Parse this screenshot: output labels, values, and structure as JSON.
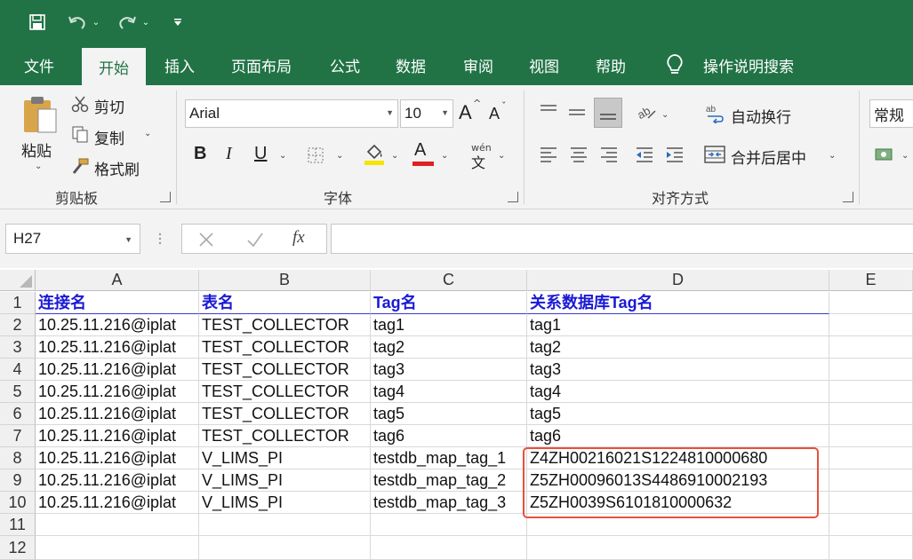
{
  "tabs": [
    {
      "label": "文件",
      "active": false
    },
    {
      "label": "开始",
      "active": true
    },
    {
      "label": "插入",
      "active": false
    },
    {
      "label": "页面布局",
      "active": false
    },
    {
      "label": "公式",
      "active": false
    },
    {
      "label": "数据",
      "active": false
    },
    {
      "label": "审阅",
      "active": false
    },
    {
      "label": "视图",
      "active": false
    },
    {
      "label": "帮助",
      "active": false
    }
  ],
  "tell_me": "操作说明搜索",
  "ribbon": {
    "clipboard": {
      "paste": "粘贴",
      "cut": "剪切",
      "copy": "复制",
      "format_painter": "格式刷",
      "label": "剪贴板"
    },
    "font": {
      "name": "Arial",
      "size": "10",
      "label": "字体",
      "bold": "B",
      "italic": "I",
      "underline": "U",
      "grow": "A",
      "shrink": "A",
      "phonetic_top": "wén",
      "phonetic_bottom": "文",
      "font_color": "A"
    },
    "alignment": {
      "wrap": "自动换行",
      "merge": "合并后居中",
      "label": "对齐方式"
    },
    "number": {
      "format": "常规"
    }
  },
  "formula_bar": {
    "name_box": "H27",
    "fx": "fx",
    "formula": ""
  },
  "columns": [
    "A",
    "B",
    "C",
    "D",
    "E"
  ],
  "rows": [
    "1",
    "2",
    "3",
    "4",
    "5",
    "6",
    "7",
    "8",
    "9",
    "10",
    "11",
    "12"
  ],
  "table": {
    "header": [
      "连接名",
      "表名",
      "Tag名",
      "关系数据库Tag名"
    ],
    "data": [
      [
        "10.25.11.216@iplat",
        "TEST_COLLECTOR",
        "tag1",
        "tag1"
      ],
      [
        "10.25.11.216@iplat",
        "TEST_COLLECTOR",
        "tag2",
        "tag2"
      ],
      [
        "10.25.11.216@iplat",
        "TEST_COLLECTOR",
        "tag3",
        "tag3"
      ],
      [
        "10.25.11.216@iplat",
        "TEST_COLLECTOR",
        "tag4",
        "tag4"
      ],
      [
        "10.25.11.216@iplat",
        "TEST_COLLECTOR",
        "tag5",
        "tag5"
      ],
      [
        "10.25.11.216@iplat",
        "TEST_COLLECTOR",
        "tag6",
        "tag6"
      ],
      [
        "10.25.11.216@iplat",
        "V_LIMS_PI",
        "testdb_map_tag_1",
        "Z4ZH00216021S1224810000680"
      ],
      [
        "10.25.11.216@iplat",
        "V_LIMS_PI",
        "testdb_map_tag_2",
        "Z5ZH00096013S4486910002193"
      ],
      [
        "10.25.11.216@iplat",
        "V_LIMS_PI",
        "testdb_map_tag_3",
        "Z5ZH0039S6101810000632"
      ]
    ]
  },
  "colors": {
    "brand": "#217346",
    "header_text": "#1a1ad6",
    "highlight": "#e8503a"
  }
}
